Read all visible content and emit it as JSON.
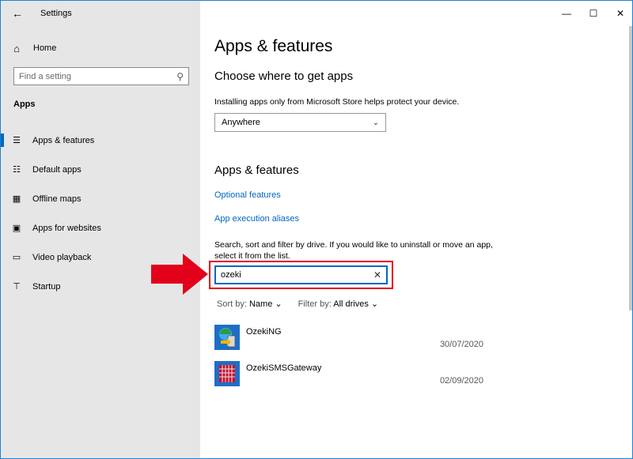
{
  "window": {
    "title": "Settings",
    "controls": {
      "minimize": "—",
      "maximize": "☐",
      "close": "✕"
    }
  },
  "sidebar": {
    "back_icon": "back-arrow-icon",
    "home": {
      "label": "Home",
      "icon": "home-icon"
    },
    "search": {
      "placeholder": "Find a setting",
      "value": ""
    },
    "section": "Apps",
    "items": [
      {
        "label": "Apps & features",
        "icon": "apps-features-icon",
        "active": true
      },
      {
        "label": "Default apps",
        "icon": "default-apps-icon",
        "active": false
      },
      {
        "label": "Offline maps",
        "icon": "offline-maps-icon",
        "active": false
      },
      {
        "label": "Apps for websites",
        "icon": "apps-websites-icon",
        "active": false
      },
      {
        "label": "Video playback",
        "icon": "video-playback-icon",
        "active": false
      },
      {
        "label": "Startup",
        "icon": "startup-icon",
        "active": false
      }
    ]
  },
  "main": {
    "title": "Apps & features",
    "choose_heading": "Choose where to get apps",
    "choose_desc": "Installing apps only from Microsoft Store helps protect your device.",
    "source_dropdown": {
      "value": "Anywhere"
    },
    "features_heading": "Apps & features",
    "links": {
      "optional_features": "Optional features",
      "execution_aliases": "App execution aliases"
    },
    "search_desc": "Search, sort and filter by drive. If you would like to uninstall or move an app, select it from the list.",
    "app_search": {
      "value": "ozeki"
    },
    "sort": {
      "label": "Sort by:",
      "value": "Name"
    },
    "filter": {
      "label": "Filter by:",
      "value": "All drives"
    },
    "apps": [
      {
        "name": "OzekiNG",
        "date": "30/07/2020",
        "icon": "ozeking-app-icon"
      },
      {
        "name": "OzekiSMSGateway",
        "date": "02/09/2020",
        "icon": "ozeki-sms-gateway-app-icon"
      }
    ]
  },
  "annotation": {
    "arrow_color": "#e3001b",
    "highlight_color": "#e3001b"
  },
  "colors": {
    "accent": "#0067c0",
    "sidebar_bg": "#e6e6e6"
  }
}
